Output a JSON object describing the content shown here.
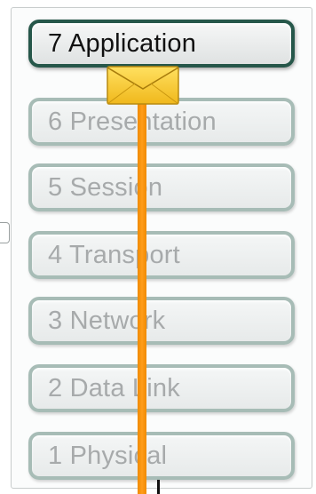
{
  "layers": [
    {
      "label": "7 Application"
    },
    {
      "label": "6 Presentation"
    },
    {
      "label": "5 Session"
    },
    {
      "label": "4 Transport"
    },
    {
      "label": "3 Network"
    },
    {
      "label": "2 Data Link"
    },
    {
      "label": "1 Physical"
    }
  ],
  "active_layer": "7 Application",
  "colors": {
    "active_border": "#26574a",
    "inactive_border": "#a7bcb6",
    "signal": "#ff9d1a",
    "envelope": "#f5c628"
  },
  "icons": {
    "message": "envelope-icon"
  }
}
